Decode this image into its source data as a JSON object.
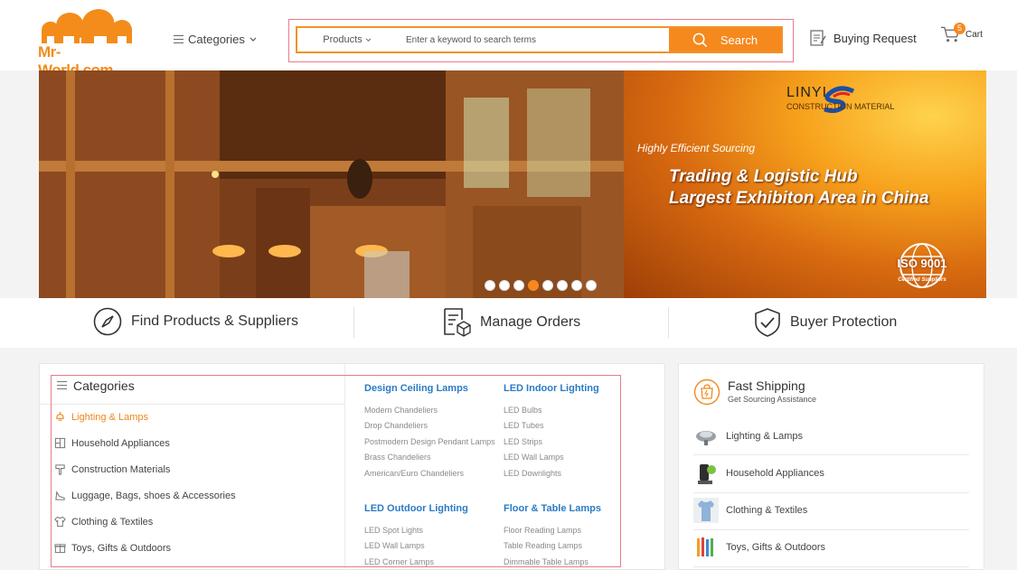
{
  "header": {
    "logo_text": "Mr-World.com",
    "categories_label": "Categories",
    "search": {
      "type_label": "Products",
      "placeholder": "Enter a keyword to search terms",
      "button_label": "Search"
    },
    "buying_request_label": "Buying Request",
    "cart": {
      "label": "Cart",
      "count": "5"
    }
  },
  "banner": {
    "brand_name": "LINYI",
    "brand_sub": "CONSTRUCTION MATERIAL",
    "subtitle": "Highly Efficient Sourcing",
    "headline_1": "Trading & Logistic Hub",
    "headline_2": "Largest Exhibiton Area in China",
    "seal_text": "ISO 9001",
    "seal_sub": "Certified Suppliers",
    "slide_count": 8,
    "active_slide": 4
  },
  "features": [
    {
      "label": "Find Products & Suppliers",
      "icon": "compass-icon"
    },
    {
      "label": "Manage Orders",
      "icon": "orders-icon"
    },
    {
      "label": "Buyer Protection",
      "icon": "shield-icon"
    }
  ],
  "categories": {
    "title": "Categories",
    "items": [
      {
        "label": "Lighting & Lamps",
        "icon": "lamp-icon",
        "active": true
      },
      {
        "label": "Household Appliances",
        "icon": "appliance-icon",
        "active": false
      },
      {
        "label": "Construction Materials",
        "icon": "tools-icon",
        "active": false
      },
      {
        "label": "Luggage, Bags, shoes & Accessories",
        "icon": "shoe-icon",
        "active": false
      },
      {
        "label": "Clothing & Textiles",
        "icon": "shirt-icon",
        "active": false
      },
      {
        "label": "Toys, Gifts & Outdoors",
        "icon": "gift-icon",
        "active": false
      }
    ],
    "subgroups": [
      {
        "title": "Design Ceiling Lamps",
        "links": [
          "Modern Chandeliers",
          "Drop Chandeliers",
          "Postmodern Design Pendant Lamps",
          "Brass Chandeliers",
          "American/Euro Chandeliers"
        ]
      },
      {
        "title": "LED Indoor Lighting",
        "links": [
          "LED Bulbs",
          "LED Tubes",
          "LED Strips",
          "LED Wall Lamps",
          "LED Downlights"
        ]
      },
      {
        "title": "LED Outdoor Lighting",
        "links": [
          "LED Spot Lights",
          "LED Wall Lamps",
          "LED Corner Lamps"
        ]
      },
      {
        "title": "Floor & Table Lamps",
        "links": [
          "Floor Reading Lamps",
          "Table Reading Lamps",
          "Dimmable Table Lamps"
        ]
      }
    ]
  },
  "fast_shipping": {
    "title": "Fast Shipping",
    "subtitle": "Get Sourcing Assistance",
    "items": [
      {
        "label": "Lighting & Lamps"
      },
      {
        "label": "Household Appliances"
      },
      {
        "label": "Clothing & Textiles"
      },
      {
        "label": "Toys, Gifts & Outdoors"
      }
    ]
  },
  "colors": {
    "accent": "#f5891e",
    "link_blue": "#2a7bc4",
    "highlight": "#e87b8c"
  }
}
